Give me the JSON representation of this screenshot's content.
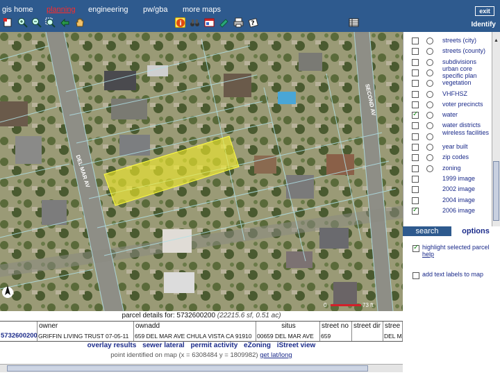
{
  "nav": {
    "items": [
      {
        "label": "gis home",
        "active": false
      },
      {
        "label": "planning",
        "active": true
      },
      {
        "label": "engineering",
        "active": false
      },
      {
        "label": "pw/gba",
        "active": false
      },
      {
        "label": "more maps",
        "active": false
      }
    ],
    "exit_label": "exit",
    "identify_label": "Identify"
  },
  "toolbar": {
    "left_tools": [
      "select-icon",
      "zoom-in-icon",
      "zoom-out-icon",
      "zoom-box-icon",
      "back-icon",
      "pan-hand-icon"
    ],
    "center_tools": [
      "identify-icon",
      "binoculars-icon",
      "print-map-icon",
      "measure-icon",
      "printer-icon",
      "help-icon"
    ],
    "right_tools": [
      "table-icon"
    ]
  },
  "map": {
    "streets": {
      "del_mar": "DEL MAR AV",
      "second": "SECOND AV"
    },
    "scale": {
      "zero": "0",
      "label": "73 ft"
    },
    "highlight_color": "#f2ec2a"
  },
  "layers": [
    {
      "label": "streets (city)",
      "checked": false
    },
    {
      "label": "streets (county)",
      "checked": false
    },
    {
      "label": "subdivisions",
      "checked": false
    },
    {
      "label": "urban core specific plan",
      "checked": false
    },
    {
      "label": "vegetation",
      "checked": false
    },
    {
      "label": "VHFHSZ",
      "checked": false
    },
    {
      "label": "voter precincts",
      "checked": false
    },
    {
      "label": "water",
      "checked": true
    },
    {
      "label": "water districts",
      "checked": false
    },
    {
      "label": "wireless facilities",
      "checked": false
    },
    {
      "label": "year built",
      "checked": false
    },
    {
      "label": "zip codes",
      "checked": false
    },
    {
      "label": "zoning",
      "checked": false
    },
    {
      "label": "1999 image",
      "checked": false,
      "radio": false
    },
    {
      "label": "2002 image",
      "checked": false,
      "radio": false
    },
    {
      "label": "2004 image",
      "checked": false,
      "radio": false
    },
    {
      "label": "2006 image",
      "checked": true,
      "radio": false
    }
  ],
  "tabs": {
    "search": "search",
    "options": "options"
  },
  "options": {
    "highlight_label": "highlight selected parcel",
    "help_label": "help",
    "labels_text": "add text labels to map"
  },
  "parcel": {
    "title": "parcel details for: 5732600200",
    "area": "(22215.6 sf, 0.51 ac)",
    "columns": [
      "",
      "owner",
      "ownadd",
      "situs",
      "street no",
      "street dir",
      "stree"
    ],
    "row": [
      "5732600200",
      "GRIFFIN LIVING TRUST 07-05-11",
      "659 DEL MAR AVE CHULA VISTA CA 91910",
      "00659 DEL MAR AVE",
      "659",
      "",
      "DEL MA"
    ]
  },
  "actions": [
    "overlay results",
    "sewer lateral",
    "permit activity",
    "eZoning",
    "iStreet view"
  ],
  "point": {
    "text": "point identified on map (x = 6308484 y = 1809982)",
    "link": "get lat/long"
  }
}
